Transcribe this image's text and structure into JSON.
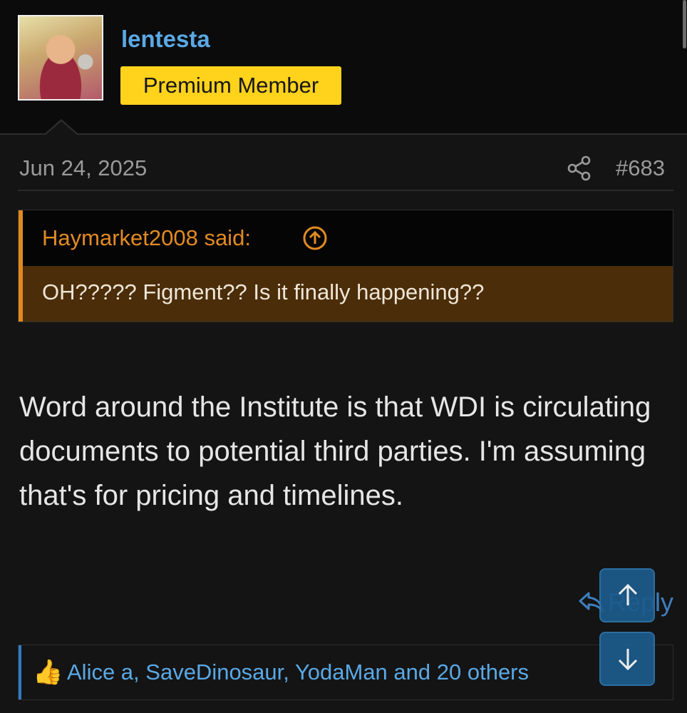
{
  "user": {
    "name": "lentesta",
    "badge": "Premium Member"
  },
  "post": {
    "date": "Jun 24, 2025",
    "number": "#683"
  },
  "quote": {
    "author": "Haymarket2008 said:",
    "text": "OH????? Figment?? Is it finally happening??"
  },
  "message": {
    "text": "Word around the Institute is that WDI is circulating documents to potential third parties. I'm assuming that's for pricing and timelines."
  },
  "actions": {
    "reply_label": "Reply"
  },
  "reactions": {
    "text": "Alice a, SaveDinosaur, YodaMan and 20 others",
    "icon": "thumbs-up-icon"
  },
  "colors": {
    "background": "#141414",
    "username": "#5aa9e6",
    "badge": "#ffd21c",
    "quote_accent": "#e08a1e",
    "quote_body": "#4b2d09",
    "link": "#5aa9e6",
    "scroll_button": "#1c5b8c"
  }
}
